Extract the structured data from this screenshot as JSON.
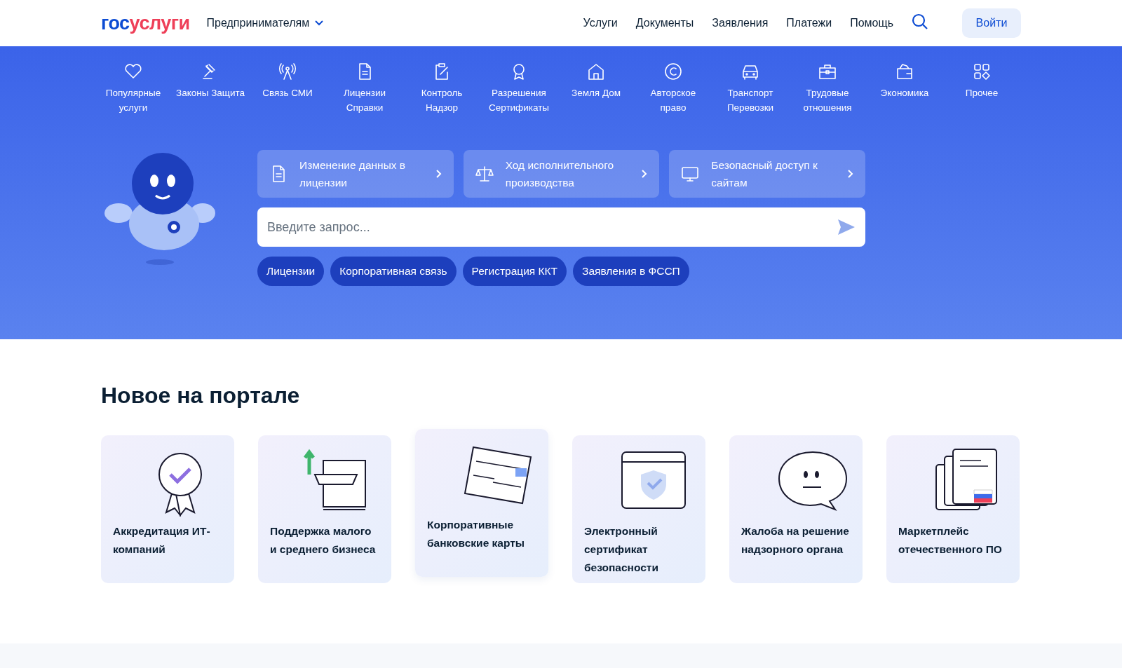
{
  "header": {
    "logo": {
      "part_1": "гос",
      "part_2": "услуги"
    },
    "audience": "Предпринимателям",
    "nav": [
      "Услуги",
      "Документы",
      "Заявления",
      "Платежи",
      "Помощь"
    ],
    "login": "Войти"
  },
  "categories": [
    {
      "kind": "heart",
      "label": "Популярные услуги"
    },
    {
      "kind": "gavel",
      "label": "Законы Защита"
    },
    {
      "kind": "antenna",
      "label": "Связь СМИ"
    },
    {
      "kind": "document",
      "label": "Лицензии Справки"
    },
    {
      "kind": "clipboard",
      "label": "Контроль Надзор"
    },
    {
      "kind": "award",
      "label": "Разрешения Сертификаты"
    },
    {
      "kind": "house",
      "label": "Земля Дом"
    },
    {
      "kind": "copyright",
      "label": "Авторское право"
    },
    {
      "kind": "car",
      "label": "Транспорт Перевозки"
    },
    {
      "kind": "briefcase",
      "label": "Трудовые отношения"
    },
    {
      "kind": "wallet",
      "label": "Экономика"
    },
    {
      "kind": "grid",
      "label": "Прочее"
    }
  ],
  "quick_links": [
    {
      "kind": "document",
      "label": "Изменение данных в лицензии"
    },
    {
      "kind": "scales",
      "label": "Ход исполнительного производства"
    },
    {
      "kind": "monitor",
      "label": "Безопасный доступ к сайтам"
    }
  ],
  "search": {
    "placeholder": "Введите запрос..."
  },
  "chips": [
    "Лицензии",
    "Корпоративная связь",
    "Регистрация ККТ",
    "Заявления в ФССП"
  ],
  "news": {
    "title": "Новое на портале",
    "cards": [
      {
        "kind": "rosette",
        "label": "Аккредитация ИТ-компаний",
        "hovered": false
      },
      {
        "kind": "shop",
        "label": "Поддержка малого и среднего бизнеса",
        "hovered": false
      },
      {
        "kind": "bankcard",
        "label": "Корпоративные банковские карты",
        "hovered": true
      },
      {
        "kind": "browser",
        "label": "Электронный сертификат безопасности",
        "hovered": false
      },
      {
        "kind": "speech",
        "label": "Жалоба на решение надзорного органа",
        "hovered": false
      },
      {
        "kind": "papers",
        "label": "Маркетплейс отечественного ПО",
        "hovered": false
      }
    ]
  }
}
